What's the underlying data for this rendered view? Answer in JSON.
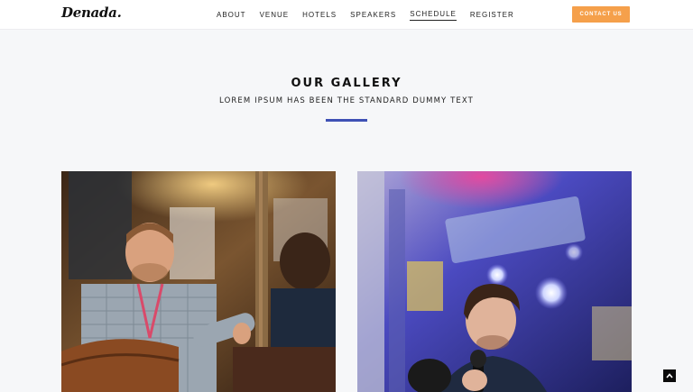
{
  "header": {
    "logo": "Denada.",
    "nav": [
      "ABOUT",
      "VENUE",
      "HOTELS",
      "SPEAKERS",
      "SCHEDULE",
      "REGISTER"
    ],
    "active_nav": "SCHEDULE",
    "contact_label": "CONTACT US"
  },
  "gallery": {
    "title": "OUR GALLERY",
    "subtitle": "LOREM IPSUM HAS BEEN THE STANDARD DUMMY TEXT"
  },
  "colors": {
    "accent_orange": "#f5a04b",
    "accent_blue": "#3f51b5",
    "background": "#f6f7f9"
  },
  "icons": {
    "scroll_top": "chevron-up-icon"
  }
}
